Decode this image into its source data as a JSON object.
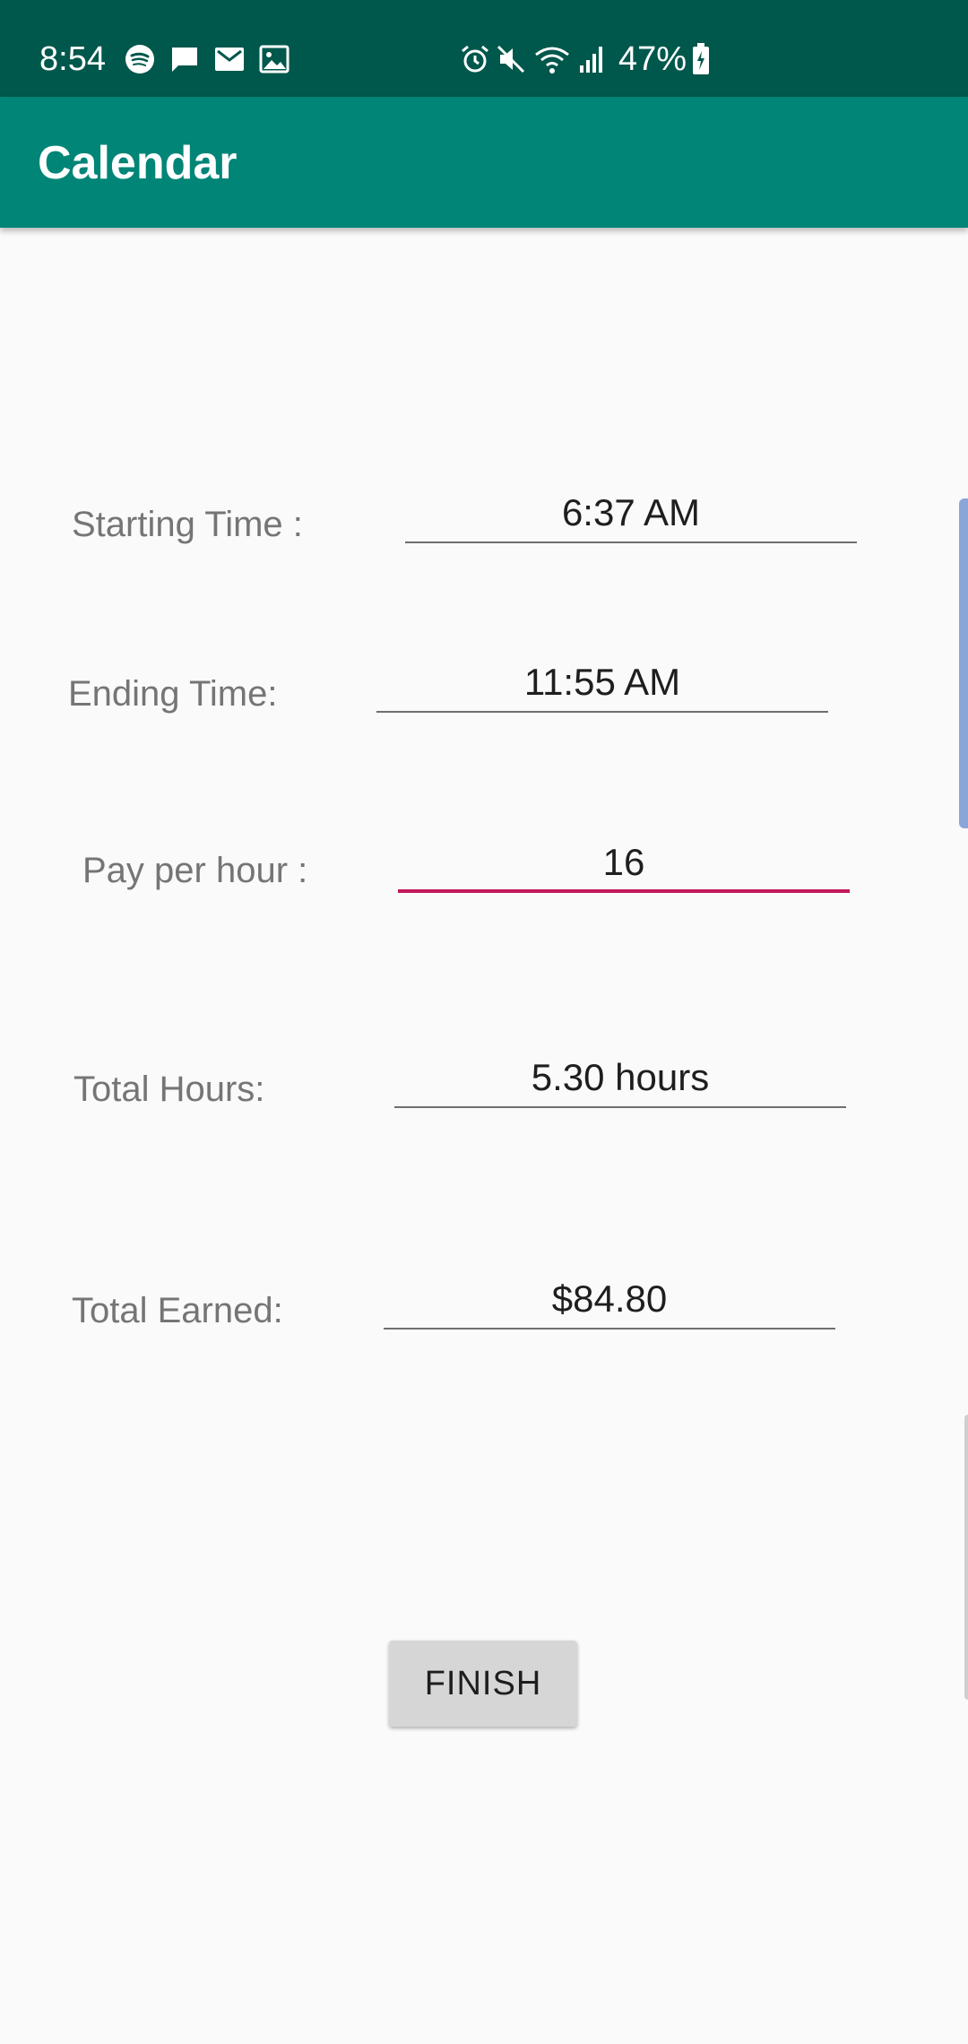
{
  "status_bar": {
    "time": "8:54",
    "battery_percent": "47%",
    "left_icons": [
      "spotify-icon",
      "message-icon",
      "gmail-icon",
      "gallery-icon"
    ],
    "right_icons": [
      "alarm-icon",
      "mute-icon",
      "wifi-icon",
      "signal-icon",
      "battery-charging-icon"
    ]
  },
  "app_bar": {
    "title": "Calendar"
  },
  "form": {
    "starting_time": {
      "label": "Starting Time :",
      "value": "6:37 AM"
    },
    "ending_time": {
      "label": "Ending Time:",
      "value": "11:55 AM"
    },
    "pay_per_hour": {
      "label": "Pay per hour :",
      "value": "16"
    },
    "total_hours": {
      "label": "Total Hours:",
      "value": "5.30 hours"
    },
    "total_earned": {
      "label": "Total Earned:",
      "value": "$84.80"
    }
  },
  "finish_button": {
    "label": "FINISH"
  },
  "colors": {
    "status_bar": "#00574b",
    "app_bar": "#008577",
    "accent": "#c2185b",
    "scroll_indicator": "#8aa6d8"
  }
}
